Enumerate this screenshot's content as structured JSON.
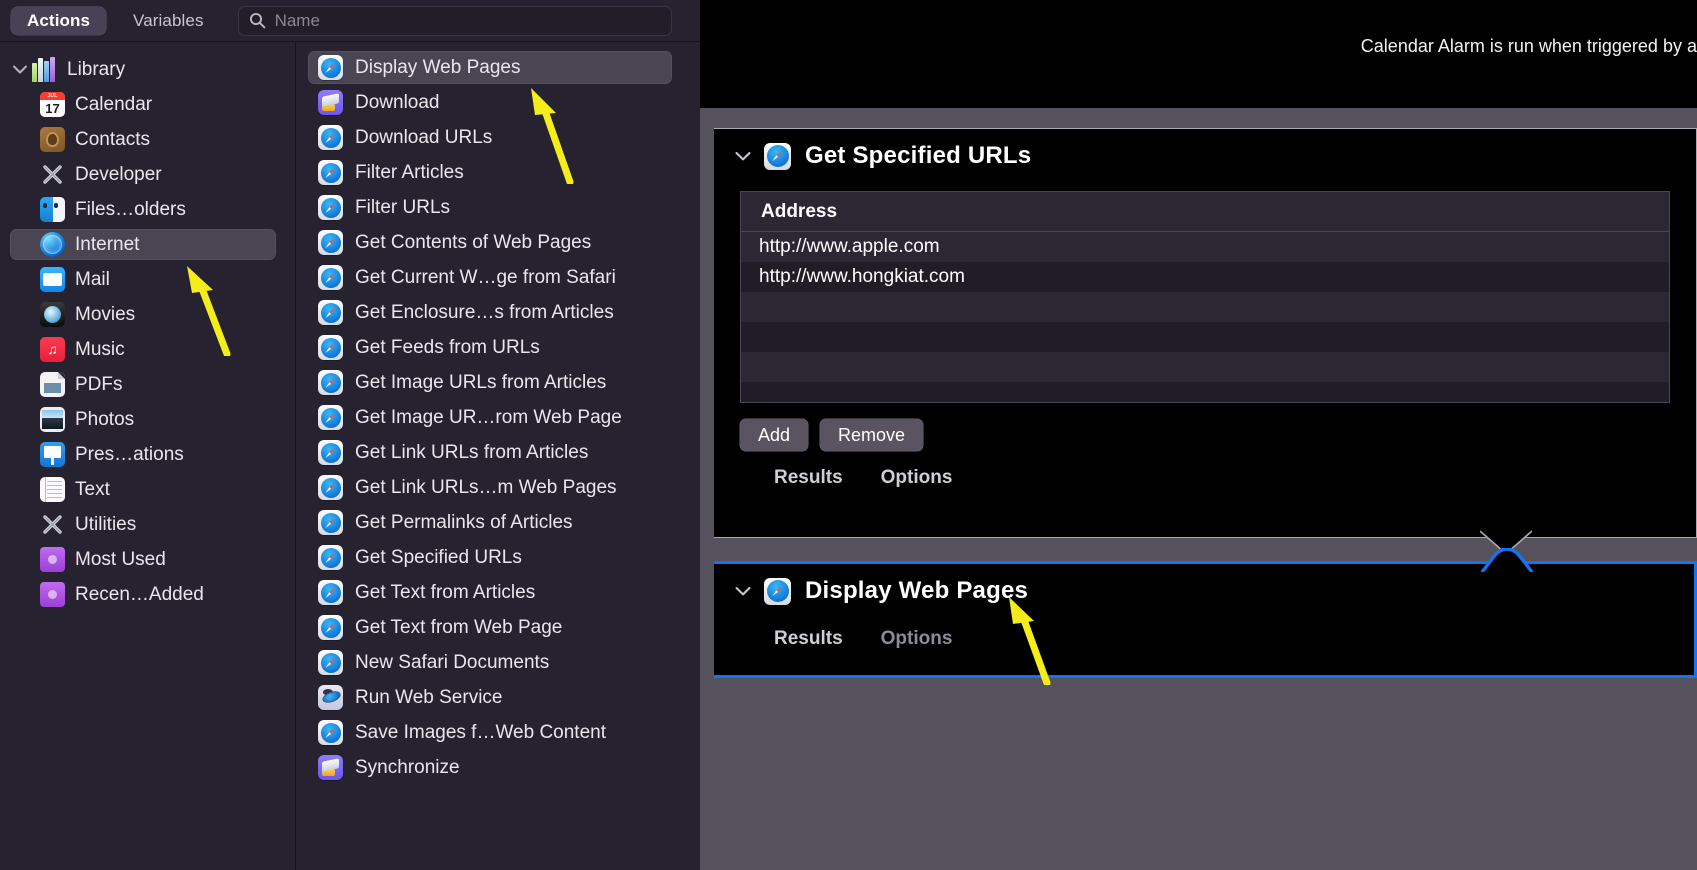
{
  "toolbar": {
    "tabs": [
      {
        "label": "Actions",
        "active": true
      },
      {
        "label": "Variables",
        "active": false
      }
    ],
    "search": {
      "placeholder": "Name",
      "value": "",
      "icon": "search-icon"
    }
  },
  "library": {
    "root": {
      "label": "Library",
      "icon": "library-icon",
      "expanded": true
    },
    "items": [
      {
        "label": "Calendar",
        "icon": "calendar-icon",
        "selected": false
      },
      {
        "label": "Contacts",
        "icon": "contacts-icon",
        "selected": false
      },
      {
        "label": "Developer",
        "icon": "developer-icon",
        "selected": false
      },
      {
        "label": "Files…olders",
        "icon": "finder-icon",
        "selected": false
      },
      {
        "label": "Internet",
        "icon": "internet-icon",
        "selected": true
      },
      {
        "label": "Mail",
        "icon": "mail-icon",
        "selected": false
      },
      {
        "label": "Movies",
        "icon": "quicktime-icon",
        "selected": false
      },
      {
        "label": "Music",
        "icon": "music-icon",
        "selected": false
      },
      {
        "label": "PDFs",
        "icon": "pdf-icon",
        "selected": false
      },
      {
        "label": "Photos",
        "icon": "photos-icon",
        "selected": false
      },
      {
        "label": "Pres…ations",
        "icon": "keynote-icon",
        "selected": false
      },
      {
        "label": "Text",
        "icon": "text-icon",
        "selected": false
      },
      {
        "label": "Utilities",
        "icon": "developer-icon",
        "selected": false
      },
      {
        "label": "Most Used",
        "icon": "folder-icon",
        "selected": false
      },
      {
        "label": "Recen…Added",
        "icon": "folder-icon",
        "selected": false
      }
    ]
  },
  "actions": {
    "items": [
      {
        "label": "Display Web Pages",
        "icon": "safari-icon",
        "selected": true
      },
      {
        "label": "Download",
        "icon": "download-icon",
        "selected": false
      },
      {
        "label": "Download URLs",
        "icon": "safari-icon",
        "selected": false
      },
      {
        "label": "Filter Articles",
        "icon": "safari-icon",
        "selected": false
      },
      {
        "label": "Filter URLs",
        "icon": "safari-icon",
        "selected": false
      },
      {
        "label": "Get Contents of Web Pages",
        "icon": "safari-icon",
        "selected": false
      },
      {
        "label": "Get Current W…ge from Safari",
        "icon": "safari-icon",
        "selected": false
      },
      {
        "label": "Get Enclosure…s from Articles",
        "icon": "safari-icon",
        "selected": false
      },
      {
        "label": "Get Feeds from URLs",
        "icon": "safari-icon",
        "selected": false
      },
      {
        "label": "Get Image URLs from Articles",
        "icon": "safari-icon",
        "selected": false
      },
      {
        "label": "Get Image UR…rom Web Page",
        "icon": "safari-icon",
        "selected": false
      },
      {
        "label": "Get Link URLs from Articles",
        "icon": "safari-icon",
        "selected": false
      },
      {
        "label": "Get Link URLs…m Web Pages",
        "icon": "safari-icon",
        "selected": false
      },
      {
        "label": "Get Permalinks of Articles",
        "icon": "safari-icon",
        "selected": false
      },
      {
        "label": "Get Specified URLs",
        "icon": "safari-icon",
        "selected": false
      },
      {
        "label": "Get Text from Articles",
        "icon": "safari-icon",
        "selected": false
      },
      {
        "label": "Get Text from Web Page",
        "icon": "safari-icon",
        "selected": false
      },
      {
        "label": "New Safari Documents",
        "icon": "safari-icon",
        "selected": false
      },
      {
        "label": "Run Web Service",
        "icon": "web-service-icon",
        "selected": false
      },
      {
        "label": "Save Images f…Web Content",
        "icon": "safari-icon",
        "selected": false
      },
      {
        "label": "Synchronize",
        "icon": "download-icon",
        "selected": false
      }
    ]
  },
  "workflow": {
    "description": "Calendar Alarm is run when triggered by a Cale",
    "cards": [
      {
        "title": "Get Specified URLs",
        "icon": "safari-icon",
        "expanded": true,
        "table": {
          "columns": [
            "Address"
          ],
          "rows": [
            [
              "http://www.apple.com"
            ],
            [
              "http://www.hongkiat.com"
            ],
            [
              ""
            ],
            [
              ""
            ],
            [
              ""
            ],
            [
              ""
            ]
          ]
        },
        "buttons": [
          {
            "label": "Add"
          },
          {
            "label": "Remove"
          }
        ],
        "tabs": [
          {
            "label": "Results",
            "dim": false
          },
          {
            "label": "Options",
            "dim": false
          }
        ]
      },
      {
        "title": "Display Web Pages",
        "icon": "safari-icon",
        "expanded": true,
        "selected": true,
        "tabs": [
          {
            "label": "Results",
            "dim": false
          },
          {
            "label": "Options",
            "dim": true
          }
        ]
      }
    ]
  },
  "annotations": {
    "arrow_color": "#f5ec1c",
    "arrows": [
      {
        "name": "arrow-to-display-web-pages-list-item"
      },
      {
        "name": "arrow-to-internet-library-item"
      },
      {
        "name": "arrow-to-display-web-pages-card"
      }
    ]
  },
  "colors": {
    "panel_bg": "#272230",
    "canvas_bg": "#55525e",
    "card_bg": "#000000",
    "selection": "#4a4553",
    "card_selected_border": "#1473f0",
    "accent_yellow": "#f5ec1c"
  }
}
